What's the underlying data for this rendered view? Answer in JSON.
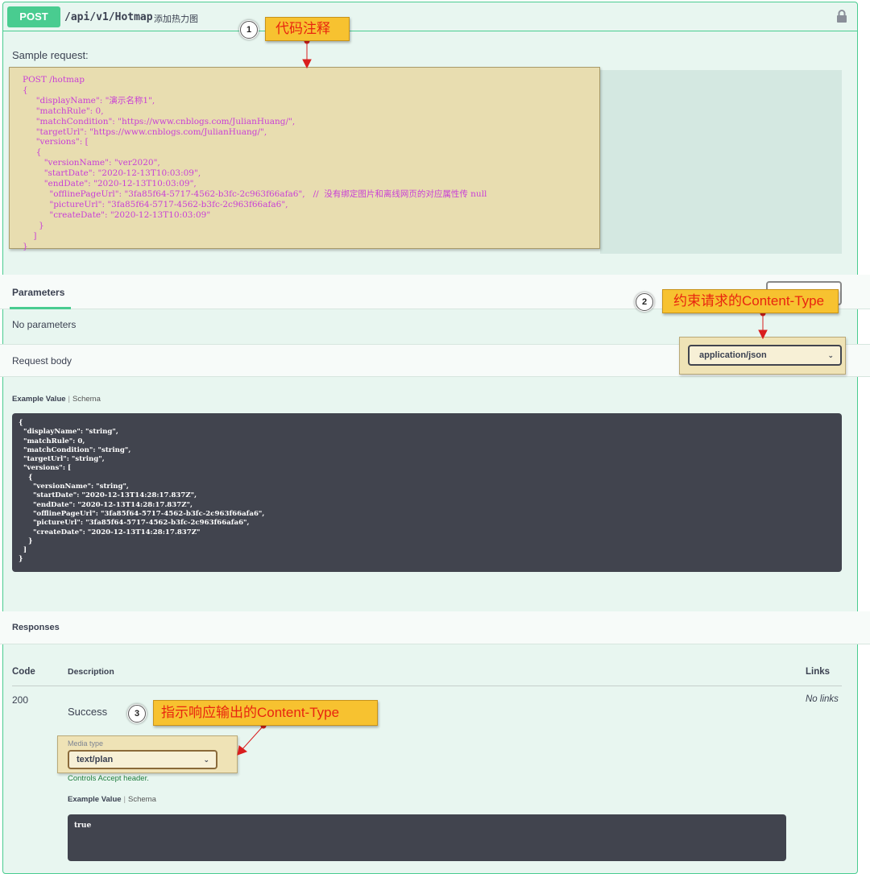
{
  "operation": {
    "method": "POST",
    "path": "/api/v1/Hotmap",
    "description": "添加热力图"
  },
  "sample": {
    "label": "Sample request:",
    "code": "POST /hotmap\n{\n     \"displayName\": \"演示名称1\",\n     \"matchRule\": 0,\n     \"matchCondition\": \"https://www.cnblogs.com/JulianHuang/\",\n     \"targetUrl\": \"https://www.cnblogs.com/JulianHuang/\",\n     \"versions\": [\n     {\n        \"versionName\": \"ver2020\",\n        \"startDate\": \"2020-12-13T10:03:09\",\n        \"endDate\": \"2020-12-13T10:03:09\",\n          \"offlinePageUrl\": \"3fa85f64-5717-4562-b3fc-2c963f66afa6\",   //  没有绑定图片和离线网页的对应属性传 null\n          \"pictureUrl\": \"3fa85f64-5717-4562-b3fc-2c963f66afa6\",\n          \"createDate\": \"2020-12-13T10:03:09\"\n      }\n    ]\n}"
  },
  "parameters": {
    "tab_label": "Parameters",
    "empty_text": "No parameters"
  },
  "request_body": {
    "label": "Request body",
    "content_type": "application/json",
    "example_tab": "Example Value",
    "schema_tab": "Schema",
    "example_code": "{\n  \"displayName\": \"string\",\n  \"matchRule\": 0,\n  \"matchCondition\": \"string\",\n  \"targetUrl\": \"string\",\n  \"versions\": [\n    {\n      \"versionName\": \"string\",\n      \"startDate\": \"2020-12-13T14:28:17.837Z\",\n      \"endDate\": \"2020-12-13T14:28:17.837Z\",\n      \"offlinePageUrl\": \"3fa85f64-5717-4562-b3fc-2c963f66afa6\",\n      \"pictureUrl\": \"3fa85f64-5717-4562-b3fc-2c963f66afa6\",\n      \"createDate\": \"2020-12-13T14:28:17.837Z\"\n    }\n  ]\n}"
  },
  "responses": {
    "title": "Responses",
    "columns": {
      "code": "Code",
      "description": "Description",
      "links": "Links"
    },
    "rows": [
      {
        "code": "200",
        "description": "Success",
        "links": "No links",
        "media_type_label": "Media type",
        "media_type": "text/plan",
        "controls_note": "Controls Accept header.",
        "example_tab": "Example Value",
        "schema_tab": "Schema",
        "example_code": "true"
      }
    ]
  },
  "annotations": [
    {
      "number": "1",
      "text": "代码注释"
    },
    {
      "number": "2",
      "text": "约束请求的Content-Type"
    },
    {
      "number": "3",
      "text": "指示响应输出的Content-Type"
    }
  ],
  "icons": {
    "lock": "lock-icon",
    "chevron": "chevron-down-icon"
  },
  "colors": {
    "post_accent": "#49cc90",
    "block_background": "#e8f6f0",
    "code_background": "#41444e",
    "callout_fill": "#f7c230",
    "callout_text": "#e8250f",
    "highlight_fill": "#e8ddb0"
  }
}
